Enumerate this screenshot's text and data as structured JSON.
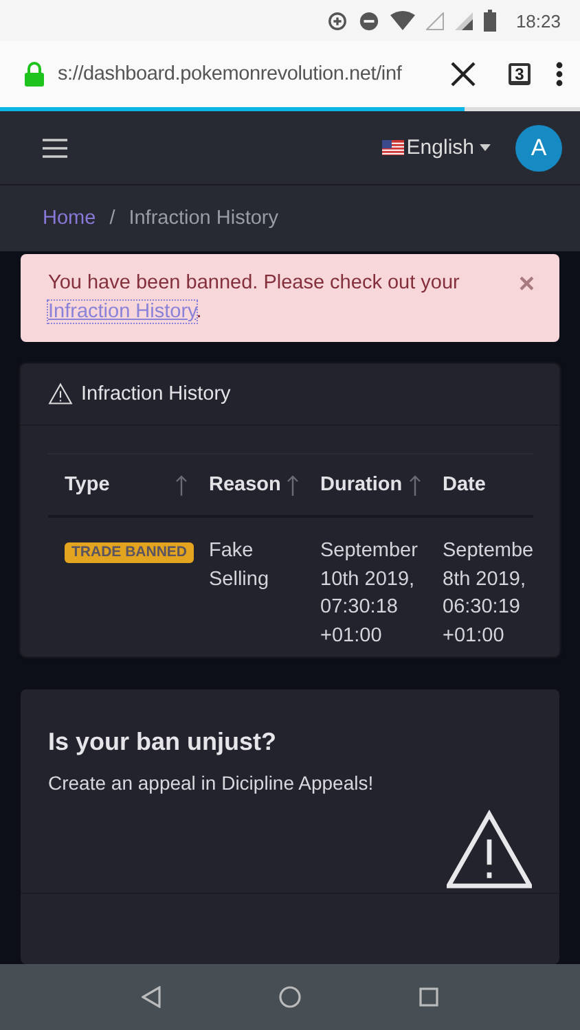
{
  "status_bar": {
    "time": "18:23"
  },
  "browser": {
    "url": "s://dashboard.pokemonrevolution.net/inf",
    "tab_count": "3",
    "load_progress": {
      "level": 0.8
    }
  },
  "navbar": {
    "language": "English",
    "avatar_letter": "A"
  },
  "breadcrumb": [
    {
      "label": "Home",
      "kind": "link"
    },
    {
      "label": "/",
      "kind": "separator"
    },
    {
      "label": "Infraction History",
      "kind": "current"
    }
  ],
  "alert": {
    "message": "You have been banned. Please check out your",
    "link": "Infraction History",
    "suffix": ".",
    "close": "×"
  },
  "infractions": {
    "title": "Infraction History",
    "columns": [
      {
        "label": "Type",
        "sortable": true
      },
      {
        "label": "Reason",
        "sortable": true
      },
      {
        "label": "Duration",
        "sortable": true
      },
      {
        "label": "Date",
        "sortable": false
      }
    ],
    "rows": [
      {
        "type": "TRADE BANNED",
        "reason": "Fake\nSelling",
        "duration": "September\n10th 2019,\n07:30:18\n+01:00",
        "date": "Septembe\n8th 2019,\n06:30:19\n+01:00"
      }
    ]
  },
  "appeal": {
    "title": "Is your ban unjust?",
    "text": "Create an appeal in Dicipline Appeals!"
  }
}
